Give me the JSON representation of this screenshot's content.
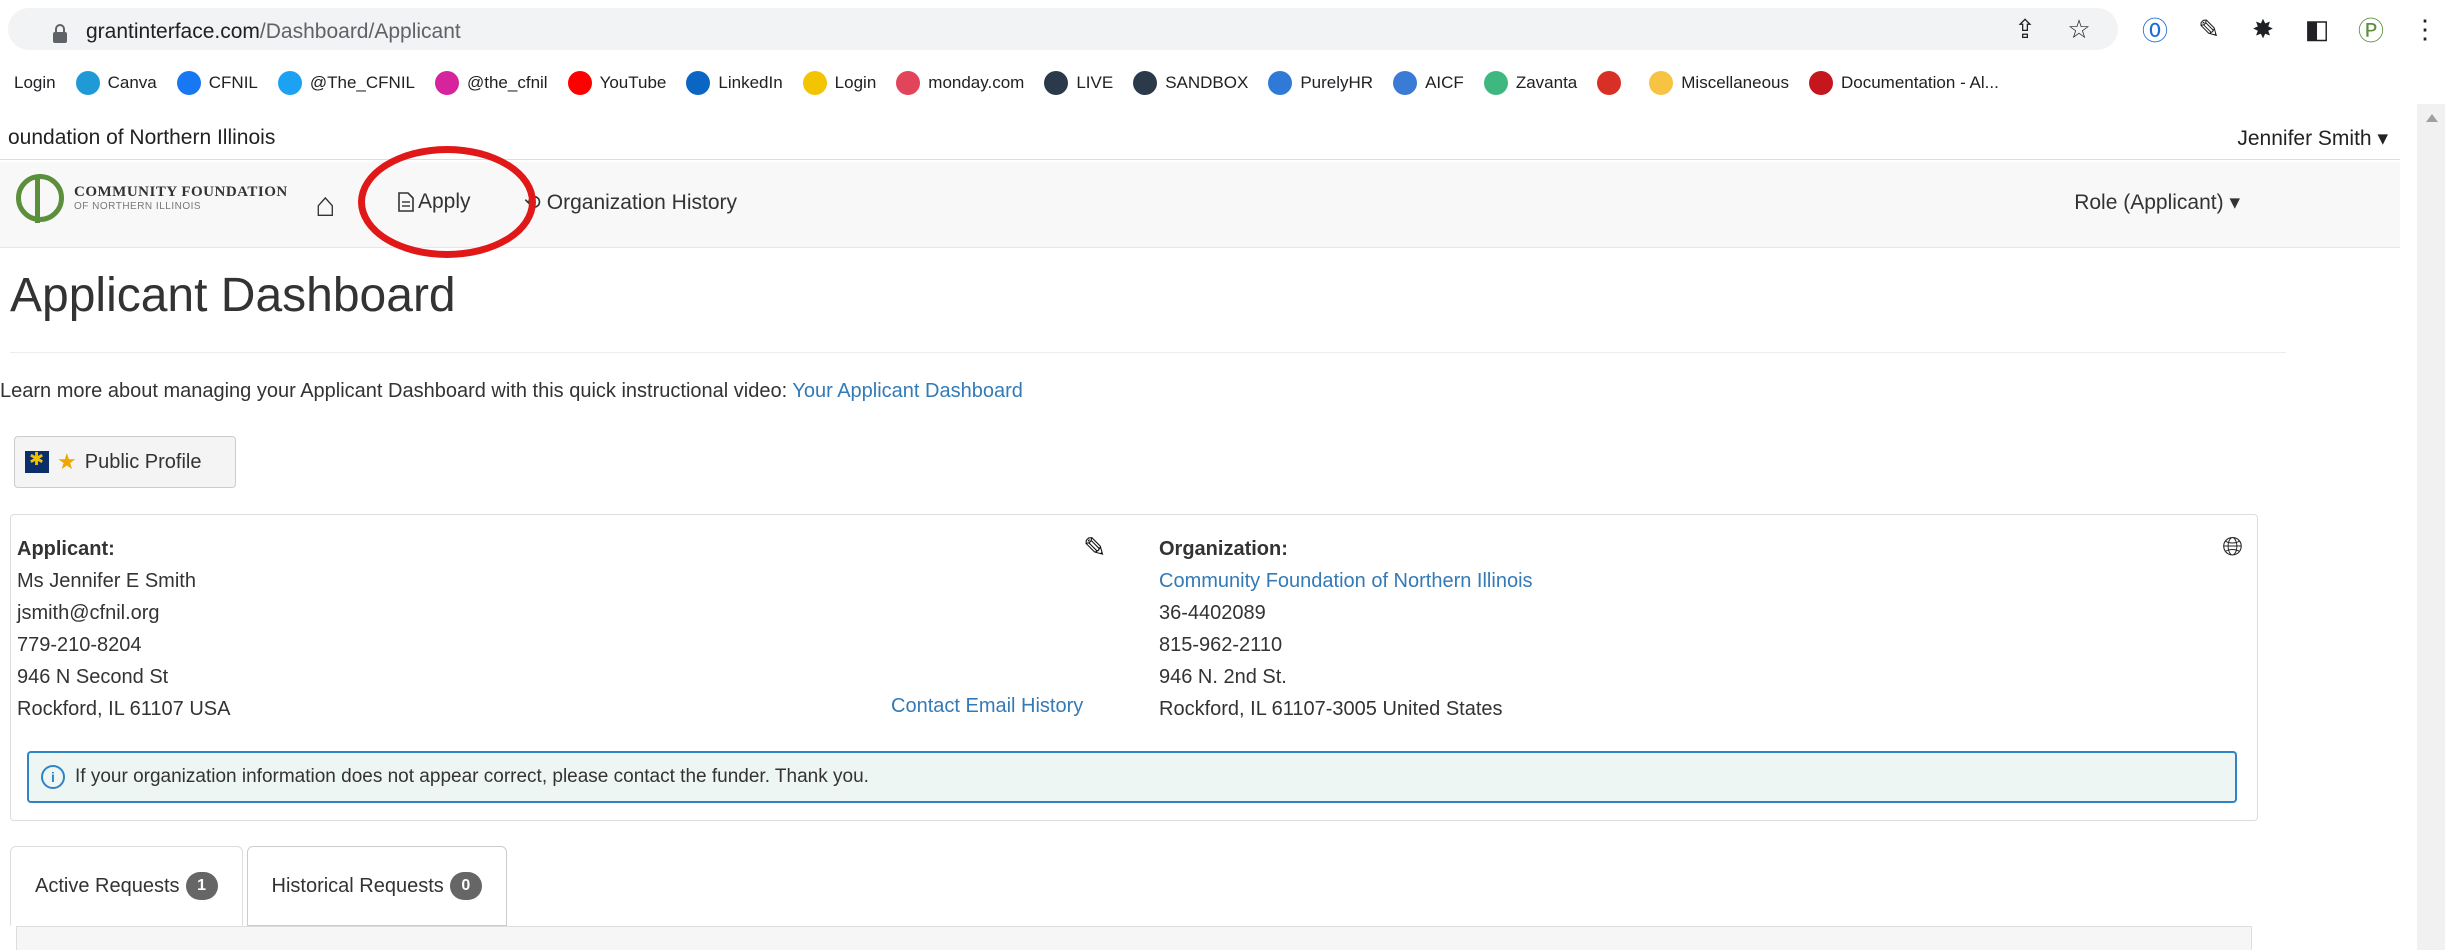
{
  "browser": {
    "url_host": "grantinterface.com",
    "url_path": "/Dashboard/Applicant",
    "icons": [
      "share-icon",
      "star-icon",
      "1password-icon",
      "pen-extension-icon",
      "puzzle-icon",
      "sidepanel-icon",
      "cfnil-extension-icon",
      "kebab-menu-icon"
    ]
  },
  "bookmarks": [
    {
      "label": "Login",
      "icon": "none",
      "color": ""
    },
    {
      "label": "Canva",
      "icon": "canva-icon",
      "color": "#1f9ad6"
    },
    {
      "label": "CFNIL",
      "icon": "facebook-icon",
      "color": "#1877f2"
    },
    {
      "label": "@The_CFNIL",
      "icon": "twitter-icon",
      "color": "#1da1f2"
    },
    {
      "label": "@the_cfnil",
      "icon": "instagram-icon",
      "color": "#d6249f"
    },
    {
      "label": "YouTube",
      "icon": "youtube-icon",
      "color": "#ff0000"
    },
    {
      "label": "LinkedIn",
      "icon": "linkedin-icon",
      "color": "#0a66c2"
    },
    {
      "label": "Login",
      "icon": "mailchimp-icon",
      "color": "#f2c500"
    },
    {
      "label": "monday.com",
      "icon": "monday-icon",
      "color": "#e2445c"
    },
    {
      "label": "LIVE",
      "icon": "live-icon",
      "color": "#2b3a4a"
    },
    {
      "label": "SANDBOX",
      "icon": "sandbox-icon",
      "color": "#2b3a4a"
    },
    {
      "label": "PurelyHR",
      "icon": "purelyhr-icon",
      "color": "#2f7ad6"
    },
    {
      "label": "AICF",
      "icon": "mail-icon",
      "color": "#3a7bd5"
    },
    {
      "label": "Zavanta",
      "icon": "zavanta-icon",
      "color": "#3fb87f"
    },
    {
      "label": "",
      "icon": "gmail-icon",
      "color": "#d93025"
    },
    {
      "label": "Miscellaneous",
      "icon": "folder-icon",
      "color": "#f6c343"
    },
    {
      "label": "Documentation - Al...",
      "icon": "doc-icon",
      "color": "#c4161c"
    }
  ],
  "header": {
    "org_name": "oundation of Northern Illinois",
    "user": "Jennifer Smith",
    "logo_line1": "COMMUNITY FOUNDATION",
    "logo_line2": "OF NORTHERN ILLINOIS",
    "nav_apply": "Apply",
    "nav_history": "Organization History",
    "role": "Role (Applicant)"
  },
  "page": {
    "title": "Applicant Dashboard",
    "intro_text": "Learn more about managing your Applicant Dashboard with this quick instructional video: ",
    "intro_link": "Your Applicant Dashboard",
    "public_profile": "Public Profile"
  },
  "applicant": {
    "label": "Applicant:",
    "name": "Ms Jennifer E Smith",
    "email": "jsmith@cfnil.org",
    "phone": "779-210-8204",
    "address1": "946 N Second St",
    "address2": "Rockford, IL 61107 USA",
    "contact_link": "Contact Email History"
  },
  "organization": {
    "label": "Organization:",
    "name": "Community Foundation of Northern Illinois",
    "ein": "36-4402089",
    "phone": "815-962-2110",
    "address1": "946 N. 2nd St.",
    "address2": "Rockford, IL 61107-3005 United States"
  },
  "alert": "If your organization information does not appear correct, please contact the funder. Thank you.",
  "tabs": [
    {
      "label": "Active Requests",
      "count": "1"
    },
    {
      "label": "Historical Requests",
      "count": "0"
    }
  ]
}
